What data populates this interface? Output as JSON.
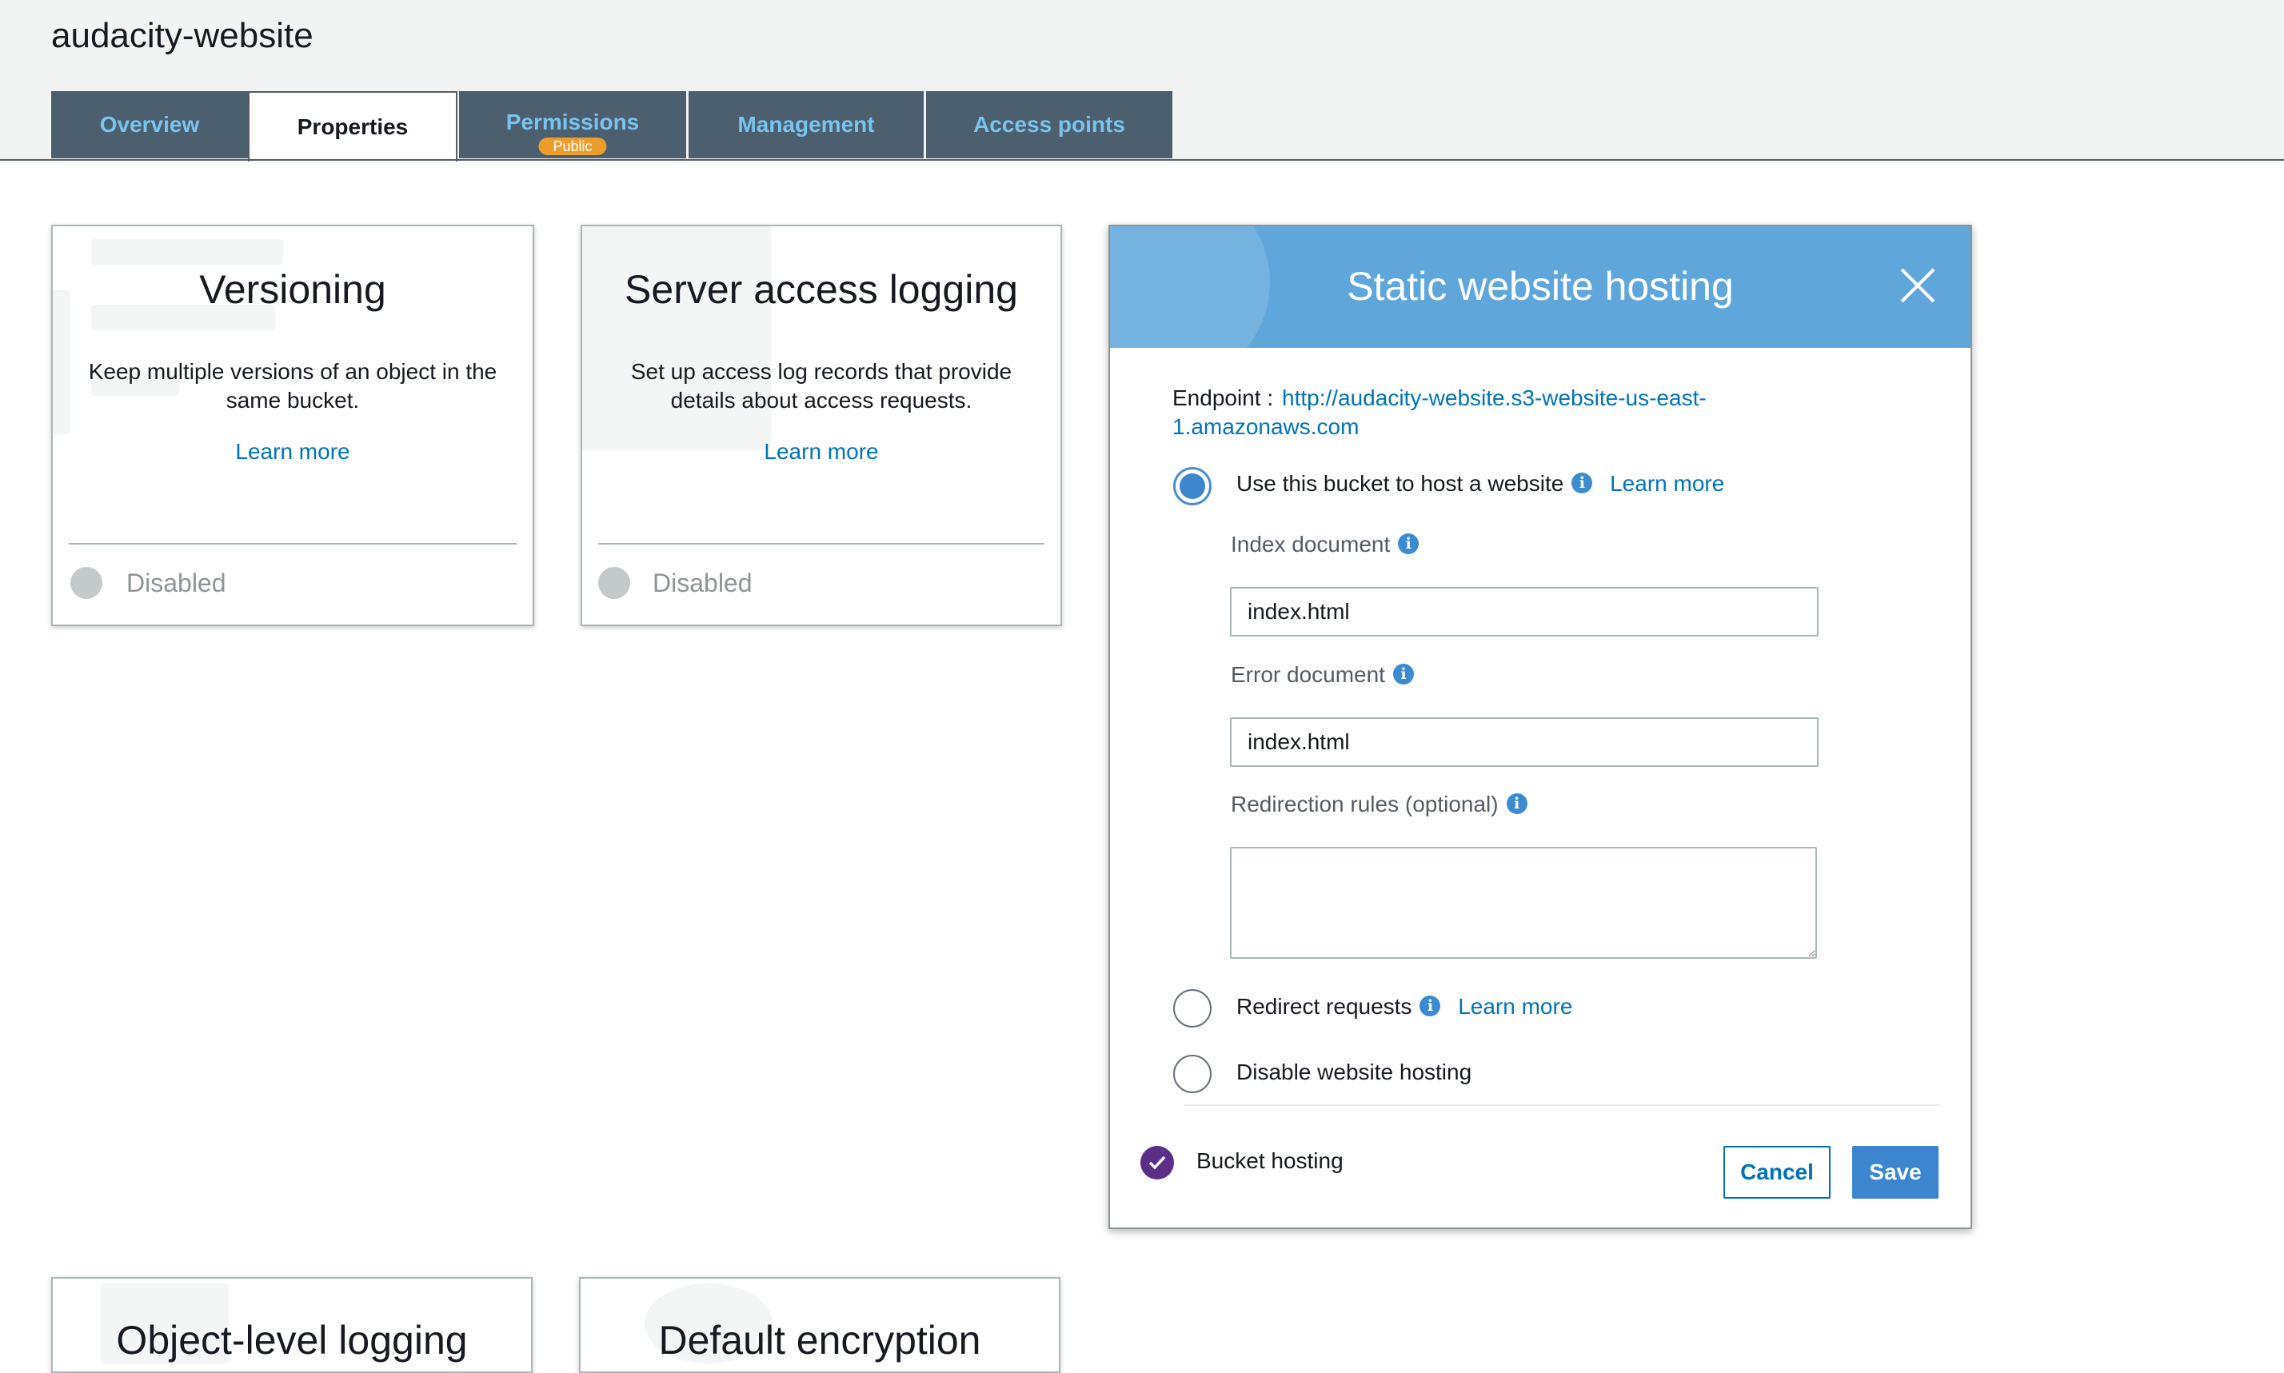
{
  "bucket": {
    "name": "audacity-website"
  },
  "tabs": [
    {
      "label": "Overview"
    },
    {
      "label": "Properties"
    },
    {
      "label": "Permissions",
      "badge": "Public"
    },
    {
      "label": "Management"
    },
    {
      "label": "Access points"
    }
  ],
  "cards": {
    "versioning": {
      "title": "Versioning",
      "description": "Keep multiple versions of an object in the same bucket.",
      "link": "Learn more",
      "status": "Disabled"
    },
    "logging": {
      "title": "Server access logging",
      "description": "Set up access log records that provide details about access requests.",
      "link": "Learn more",
      "status": "Disabled"
    },
    "object_logging": {
      "title": "Object-level logging"
    },
    "encryption": {
      "title": "Default encryption"
    }
  },
  "modal": {
    "title": "Static website hosting",
    "endpoint_label": "Endpoint : ",
    "endpoint_url": "http://audacity-website.s3-website-us-east-1.amazonaws.com",
    "option_host": "Use this bucket to host a website",
    "option_host_link": "Learn more",
    "index_label": "Index document",
    "index_value": "index.html",
    "error_label": "Error document",
    "error_value": "index.html",
    "redirection_label": "Redirection rules (optional)",
    "redirection_value": "",
    "option_redirect": "Redirect requests",
    "option_redirect_link": "Learn more",
    "option_disable": "Disable website hosting",
    "footer_status": "Bucket hosting",
    "cancel": "Cancel",
    "save": "Save"
  },
  "colors": {
    "tab_bg": "#4c5f6f",
    "tab_text": "#79c4ef",
    "link": "#0073bb",
    "modal_header": "#5fa6da",
    "badge": "#ec9d2c",
    "bucket_hosting_check": "#5b2f88"
  },
  "icons": [
    "info-icon",
    "close-icon",
    "check-icon",
    "globe-icon"
  ]
}
